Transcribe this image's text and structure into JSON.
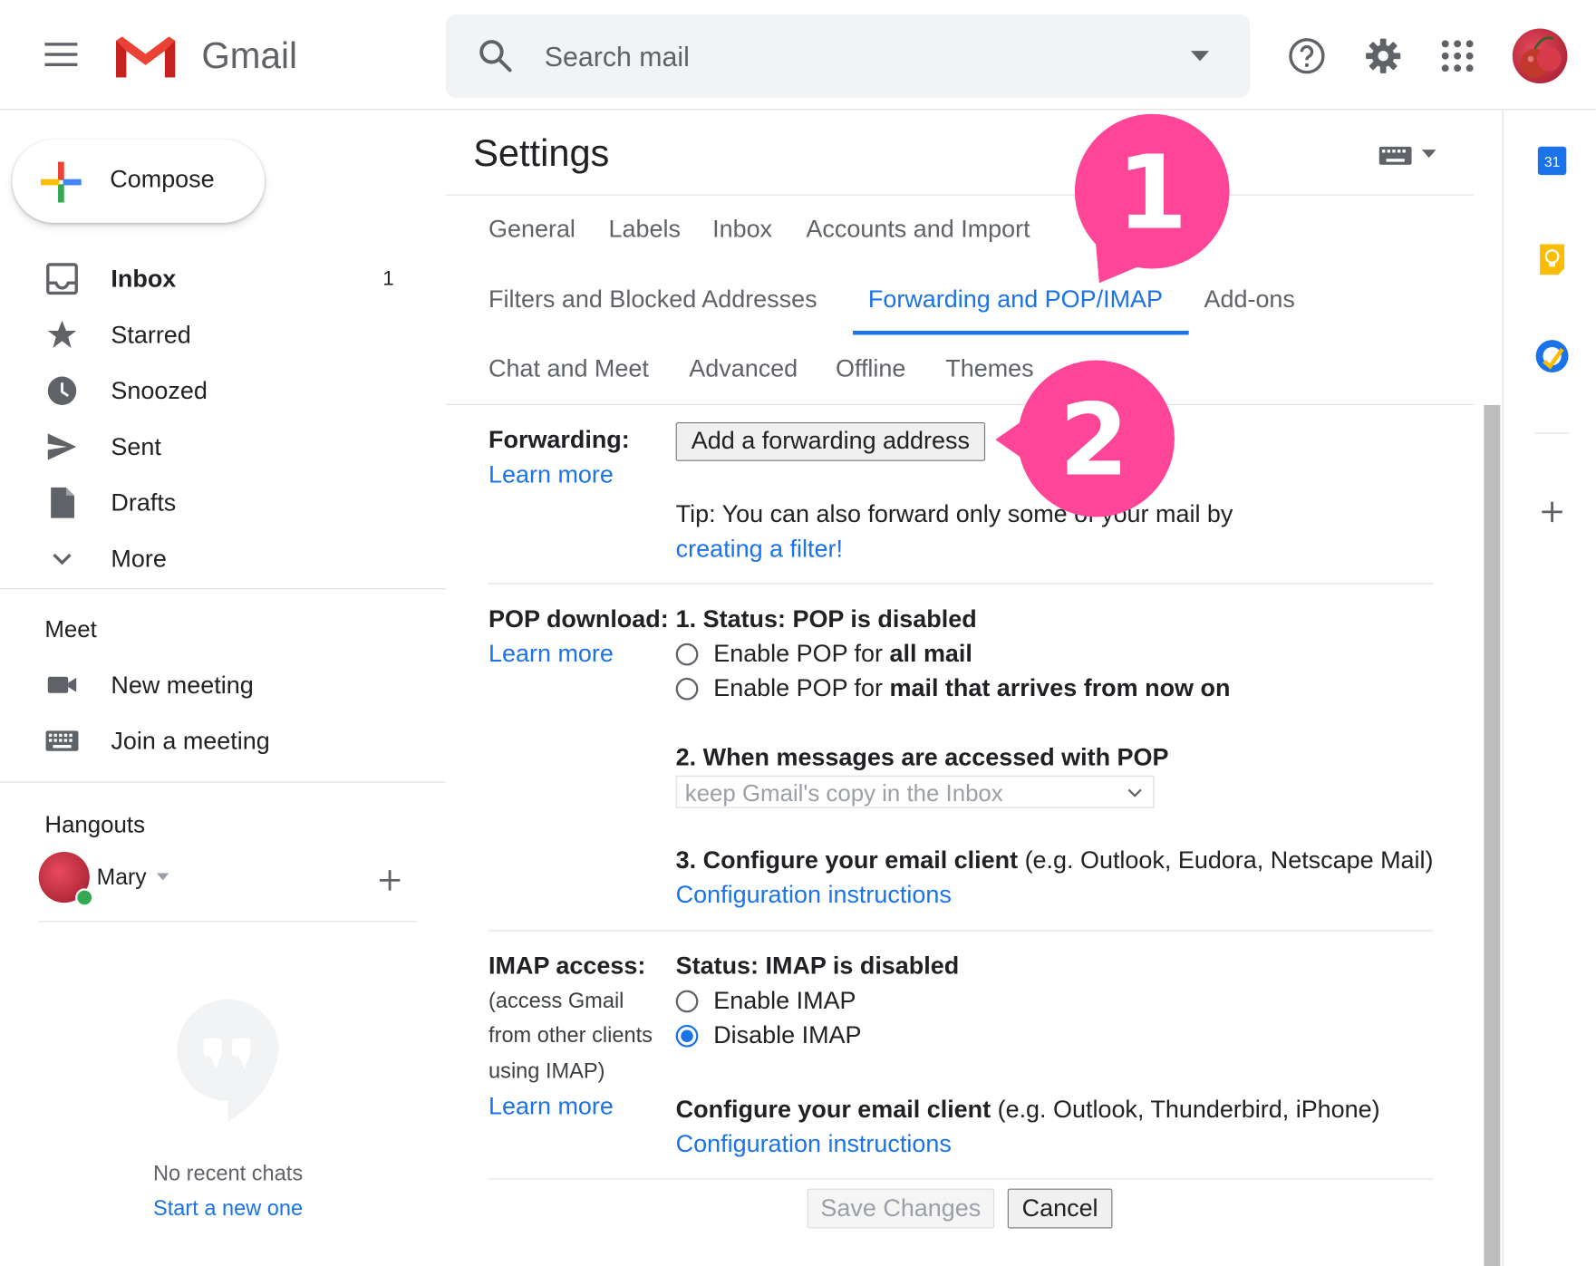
{
  "header": {
    "app_title": "Gmail",
    "search_placeholder": "Search mail"
  },
  "sidebar": {
    "compose_label": "Compose",
    "items": [
      {
        "label": "Inbox",
        "count": "1",
        "icon": "inbox-icon"
      },
      {
        "label": "Starred",
        "icon": "star-icon"
      },
      {
        "label": "Snoozed",
        "icon": "clock-icon"
      },
      {
        "label": "Sent",
        "icon": "send-icon"
      },
      {
        "label": "Drafts",
        "icon": "draft-icon"
      },
      {
        "label": "More",
        "icon": "chevron-down-icon"
      }
    ],
    "meet": {
      "title": "Meet",
      "new_meeting": "New meeting",
      "join_meeting": "Join a meeting"
    },
    "hangouts": {
      "title": "Hangouts",
      "user_name": "Mary",
      "no_chats": "No recent chats",
      "start_new": "Start a new one"
    }
  },
  "settings": {
    "title": "Settings",
    "tabs": [
      "General",
      "Labels",
      "Inbox",
      "Accounts and Import",
      "Filters and Blocked Addresses",
      "Forwarding and POP/IMAP",
      "Add-ons",
      "Chat and Meet",
      "Advanced",
      "Offline",
      "Themes"
    ],
    "active_tab": "Forwarding and POP/IMAP",
    "forwarding": {
      "label": "Forwarding:",
      "learn_more": "Learn more",
      "add_button": "Add a forwarding address",
      "tip_text": "Tip: You can also forward only some of your mail by",
      "tip_link": "creating a filter!"
    },
    "pop": {
      "label": "POP download:",
      "learn_more": "Learn more",
      "status": "1. Status: POP is disabled",
      "option1_prefix": "Enable POP for ",
      "option1_bold": "all mail",
      "option2_prefix": "Enable POP for ",
      "option2_bold": "mail that arrives from now on",
      "when_heading": "2. When messages are accessed with POP",
      "select_value": "keep Gmail's copy in the Inbox",
      "configure_bold": "3. Configure your email client",
      "configure_rest": " (e.g. Outlook, Eudora, Netscape Mail)",
      "config_link": "Configuration instructions"
    },
    "imap": {
      "label": "IMAP access:",
      "desc_line1": "(access Gmail",
      "desc_line2": "from other clients",
      "desc_line3": "using IMAP)",
      "learn_more": "Learn more",
      "status": "Status: IMAP is disabled",
      "enable": "Enable IMAP",
      "disable": "Disable IMAP",
      "selected": "Disable IMAP",
      "configure_bold": "Configure your email client",
      "configure_rest": " (e.g. Outlook, Thunderbird, iPhone)",
      "config_link": "Configuration instructions"
    },
    "save_button": "Save Changes",
    "cancel_button": "Cancel"
  },
  "annotations": {
    "step1": "1",
    "step2": "2",
    "color": "#ff4597"
  },
  "right_panel": {
    "calendar_day": "31"
  },
  "colors": {
    "accent": "#1a73e8",
    "annotation": "#ff4597"
  }
}
